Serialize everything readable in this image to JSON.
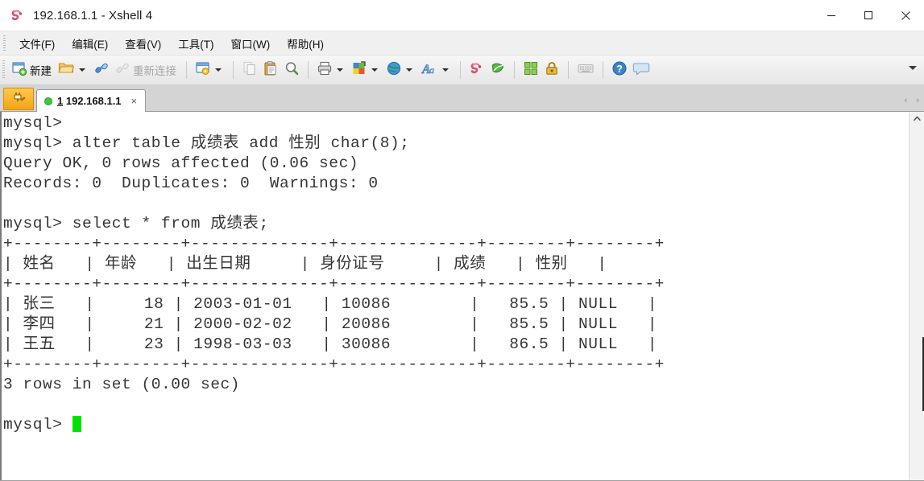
{
  "window": {
    "title": "192.168.1.1 - Xshell 4",
    "icon": "xshell-logo-icon",
    "controls": {
      "minimize": "minimize-button",
      "maximize": "maximize-button",
      "close": "close-button"
    }
  },
  "menubar": {
    "items": [
      {
        "label": "文件(F)"
      },
      {
        "label": "编辑(E)"
      },
      {
        "label": "查看(V)"
      },
      {
        "label": "工具(T)"
      },
      {
        "label": "窗口(W)"
      },
      {
        "label": "帮助(H)"
      }
    ]
  },
  "toolbar": {
    "new_label": "新建",
    "reconnect_label": "重新连接",
    "buttons": [
      {
        "name": "new-session-button",
        "icon": "new-window-icon",
        "label": "新建"
      },
      {
        "name": "open-folder-button",
        "icon": "folder-open-icon",
        "dropdown": true
      },
      {
        "name": "connect-button",
        "icon": "connect-link-icon"
      },
      {
        "name": "reconnect-button",
        "icon": "broken-link-icon",
        "label": "重新连接",
        "disabled": true
      },
      {
        "name": "session-properties-button",
        "icon": "window-gear-icon",
        "dropdown": true
      },
      {
        "name": "copy-button",
        "icon": "copy-icon",
        "disabled": true
      },
      {
        "name": "paste-button",
        "icon": "clipboard-paste-icon"
      },
      {
        "name": "find-button",
        "icon": "magnifier-icon"
      },
      {
        "name": "print-button",
        "icon": "printer-icon",
        "dropdown": true
      },
      {
        "name": "color-scheme-button",
        "icon": "color-palette-icon",
        "dropdown": true
      },
      {
        "name": "web-button",
        "icon": "globe-icon",
        "dropdown": true
      },
      {
        "name": "font-button",
        "icon": "font-a-icon",
        "dropdown": true
      },
      {
        "name": "xshell-button",
        "icon": "xshell-red-icon"
      },
      {
        "name": "xftp-button",
        "icon": "xftp-green-icon"
      },
      {
        "name": "layout-button",
        "icon": "tile-grid-icon"
      },
      {
        "name": "lock-button",
        "icon": "padlock-icon"
      },
      {
        "name": "keyboard-button",
        "icon": "keyboard-icon",
        "disabled": true
      },
      {
        "name": "help-button",
        "icon": "question-mark-icon"
      },
      {
        "name": "chat-button",
        "icon": "speech-bubble-icon"
      }
    ],
    "overflow": "toolbar-overflow-icon"
  },
  "tabbar": {
    "launcher": {
      "name": "session-launcher-button",
      "icon": "orange-plug-icon"
    },
    "tabs": [
      {
        "status": "connected",
        "number": "1",
        "host": "192.168.1.1",
        "close": "×"
      }
    ],
    "scroll_left": "‹",
    "scroll_right": "›"
  },
  "terminal": {
    "cursor": "block-cursor",
    "lines": [
      "mysql>",
      "mysql> alter table 成绩表 add 性别 char(8);",
      "Query OK, 0 rows affected (0.06 sec)",
      "Records: 0  Duplicates: 0  Warnings: 0",
      "",
      "mysql> select * from 成绩表;",
      "+--------+--------+--------------+--------------+--------+--------+",
      "| 姓名   | 年龄   | 出生日期     | 身份证号     | 成绩   | 性别   |",
      "+--------+--------+--------------+--------------+--------+--------+",
      "| 张三   |     18 | 2003-01-01   | 10086        |   85.5 | NULL   |",
      "| 李四   |     21 | 2000-02-02   | 20086        |   85.5 | NULL   |",
      "| 王五   |     23 | 1998-03-03   | 30086        |   86.5 | NULL   |",
      "+--------+--------+--------------+--------------+--------+--------+",
      "3 rows in set (0.00 sec)",
      "",
      "mysql> "
    ],
    "sql_result": {
      "columns": [
        "姓名",
        "年龄",
        "出生日期",
        "身份证号",
        "成绩",
        "性别"
      ],
      "rows": [
        [
          "张三",
          "18",
          "2003-01-01",
          "10086",
          "85.5",
          "NULL"
        ],
        [
          "李四",
          "21",
          "2000-02-02",
          "20086",
          "85.5",
          "NULL"
        ],
        [
          "王五",
          "23",
          "1998-03-03",
          "30086",
          "86.5",
          "NULL"
        ]
      ],
      "row_count_text": "3 rows in set (0.00 sec)",
      "alter_statement": "alter table 成绩表 add 性别 char(8);",
      "alter_result": "Query OK, 0 rows affected (0.06 sec)",
      "alter_records": "Records: 0  Duplicates: 0  Warnings: 0",
      "select_statement": "select * from 成绩表;",
      "prompt": "mysql>"
    }
  },
  "scrollbar": {
    "up_arrow": "scroll-up-arrow-icon"
  },
  "colors": {
    "cursor_green": "#00e000",
    "tab_active_bg": "#ffffff",
    "terminal_text": "#353535",
    "toolbar_bg": "#ededed"
  }
}
